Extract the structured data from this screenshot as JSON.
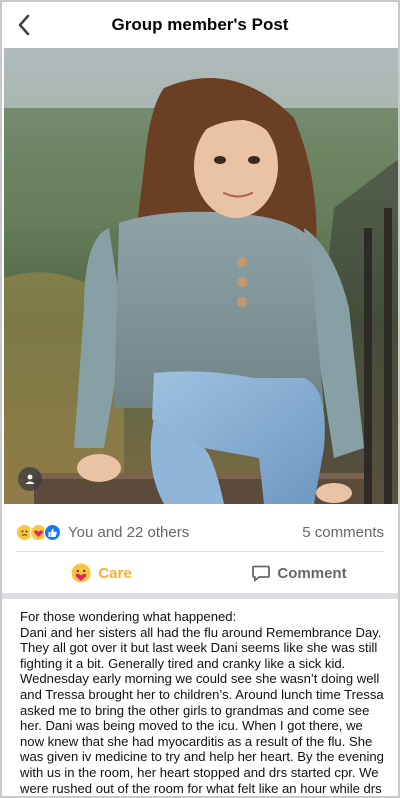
{
  "header": {
    "title": "Group member's Post"
  },
  "post": {
    "reactions_text": "You and 22 others",
    "comments_count": "5 comments",
    "reaction_icons": [
      "sad-react-icon",
      "care-react-icon",
      "like-react-icon"
    ],
    "actions": {
      "care_label": "Care",
      "comment_label": "Comment"
    },
    "body": {
      "intro": "For those wondering what happened:",
      "story": "Dani and her sisters all had the flu around Remembrance Day. They all got over it but last week Dani seems like she was still fighting it a bit. Generally tired and cranky like a sick kid. Wednesday early morning we could see she wasn’t doing well and Tressa brought her to children’s. Around lunch time Tressa asked me to bring the other girls to grandmas and come see her. Dani was being moved to the icu. When I got there, we now knew that she had myocarditis as a result of the flu. She was given iv medicine to try and help her heart. By the evening with us in the room, her heart stopped and drs started cpr. We were rushed out of the room for what felt like an hour while drs hooked her to a gene"
    }
  },
  "colors": {
    "care": "#f7b125",
    "like": "#1877f2",
    "muted": "#65676b",
    "divider": "#dadde1"
  }
}
